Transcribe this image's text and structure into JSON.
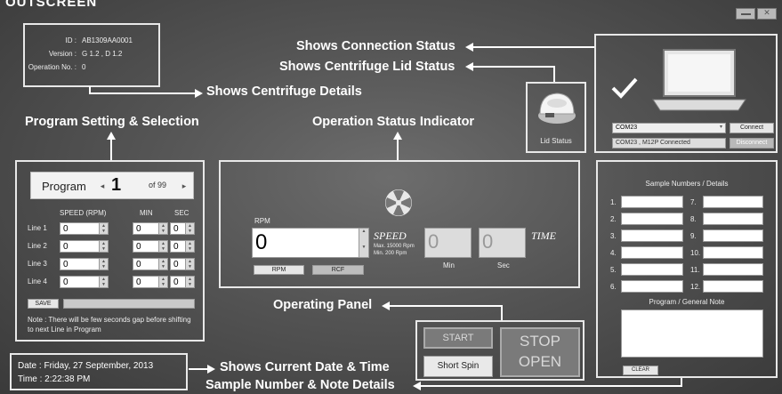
{
  "header": {
    "title": "OUTSCREEN"
  },
  "window_controls": {
    "minimize_label": "",
    "close_label": ""
  },
  "device": {
    "id_label": "ID",
    "id_value": "AB1309AA0001",
    "version_label": "Version",
    "version_value": "G 1.2 , D 1.2",
    "opno_label": "Operation No.",
    "opno_value": "0"
  },
  "annotations": {
    "connection": "Shows Connection Status",
    "lid": "Shows Centrifuge Lid Status",
    "details": "Shows Centrifuge Details",
    "program": "Program Setting & Selection",
    "operation": "Operation Status Indicator",
    "operating_panel": "Operating Panel",
    "datetime": "Shows Current Date & Time",
    "sample": "Sample Number & Note Details"
  },
  "connection": {
    "port_value": "COM23",
    "connect_label": "Connect",
    "status_value": "COM23 , M12P Connected",
    "disconnect_label": "Disconnect",
    "lid_status_label": "Lid Status"
  },
  "program": {
    "label": "Program",
    "number": "1",
    "of_label": "of 99",
    "col_speed": "SPEED  (RPM)",
    "col_min": "MIN",
    "col_sec": "SEC",
    "lines": [
      {
        "label": "Line 1",
        "speed": "0",
        "min": "0",
        "sec": "0"
      },
      {
        "label": "Line 2",
        "speed": "0",
        "min": "0",
        "sec": "0"
      },
      {
        "label": "Line 3",
        "speed": "0",
        "min": "0",
        "sec": "0"
      },
      {
        "label": "Line 4",
        "speed": "0",
        "min": "0",
        "sec": "0"
      }
    ],
    "save_label": "SAVE",
    "note": "Note : There will be few seconds gap before shifting to next Line in Program"
  },
  "status": {
    "rpm_label": "RPM",
    "speed_value": "0",
    "speed_label": "SPEED",
    "max_speed": "Max. 15000 Rpm",
    "min_speed": "Min. 200 Rpm",
    "min_value": "0",
    "sec_value": "0",
    "time_label": "TIME",
    "min_label": "Min",
    "sec_label": "Sec",
    "rpm_button": "RPM",
    "rcf_button": "RCF"
  },
  "operating": {
    "start_label": "START",
    "short_spin_label": "Short Spin",
    "stop_label": "STOP",
    "open_label": "OPEN"
  },
  "datetime": {
    "date_text": "Date : Friday, 27 September, 2013",
    "time_text": "Time : 2:22:38 PM"
  },
  "samples": {
    "title": "Sample Numbers / Details",
    "left_numbers": [
      "1.",
      "2.",
      "3.",
      "4.",
      "5.",
      "6."
    ],
    "right_numbers": [
      "7.",
      "8.",
      "9.",
      "10.",
      "11.",
      "12."
    ],
    "note_label": "Program / General  Note",
    "clear_label": "CLEAR"
  }
}
